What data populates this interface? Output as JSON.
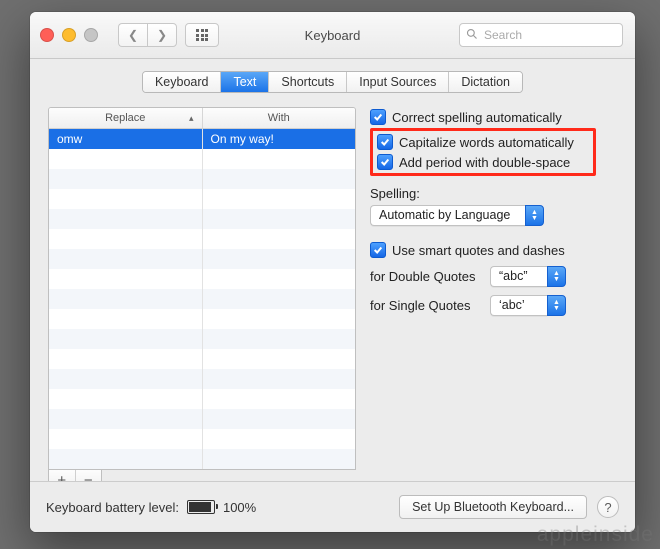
{
  "window": {
    "title": "Keyboard"
  },
  "toolbar": {
    "search_placeholder": "Search"
  },
  "tabs": {
    "items": [
      "Keyboard",
      "Text",
      "Shortcuts",
      "Input Sources",
      "Dictation"
    ],
    "active_index": 1
  },
  "table": {
    "headers": {
      "replace": "Replace",
      "with": "With"
    },
    "row": {
      "replace": "omw",
      "with": "On my way!"
    }
  },
  "options": {
    "correct_spelling": "Correct spelling automatically",
    "capitalize": "Capitalize words automatically",
    "add_period": "Add period with double-space",
    "spelling_label": "Spelling:",
    "spelling_value": "Automatic by Language",
    "smart_quotes": "Use smart quotes and dashes",
    "double_quotes_label": "for Double Quotes",
    "double_quotes_value": "“abc”",
    "single_quotes_label": "for Single Quotes",
    "single_quotes_value": "‘abc’"
  },
  "footer": {
    "battery_label": "Keyboard battery level:",
    "battery_pct": "100%",
    "bluetooth_button": "Set Up Bluetooth Keyboard..."
  },
  "watermark": "appleinside"
}
